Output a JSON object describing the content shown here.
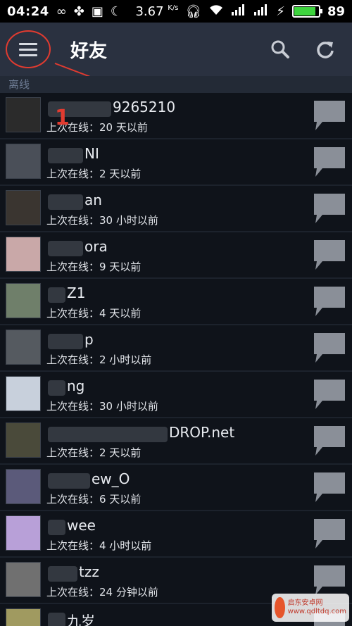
{
  "status": {
    "time": "04:24",
    "speed": "3.67",
    "speed_unit": "K/s",
    "battery": "89",
    "battery_fraction": 0.89
  },
  "appbar": {
    "title": "好友"
  },
  "section": {
    "title": "离线"
  },
  "annotation": {
    "number": "1"
  },
  "friends": [
    {
      "name": "9265210",
      "status": "上次在线：20 天以前"
    },
    {
      "name": "NI",
      "status": "上次在线：2 天以前"
    },
    {
      "name": "an",
      "status": "上次在线：30 小时以前"
    },
    {
      "name": "ora",
      "status": "上次在线：9 天以前"
    },
    {
      "name": "Z1",
      "status": "上次在线：4 天以前"
    },
    {
      "name": "p",
      "status": "上次在线：2 小时以前"
    },
    {
      "name": "ng",
      "status": "上次在线：30 小时以前"
    },
    {
      "name": "DROP.net",
      "status": "上次在线：2 天以前"
    },
    {
      "name": "ew_O",
      "status": "上次在线：6 天以前"
    },
    {
      "name": "wee",
      "status": "上次在线：4 小时以前"
    },
    {
      "name": "tzz",
      "status": "上次在线：24 分钟以前"
    },
    {
      "name": "九岁",
      "status": ""
    }
  ],
  "watermark": {
    "line1": "启东安卓网",
    "line2": "www.qdltdq.com"
  }
}
